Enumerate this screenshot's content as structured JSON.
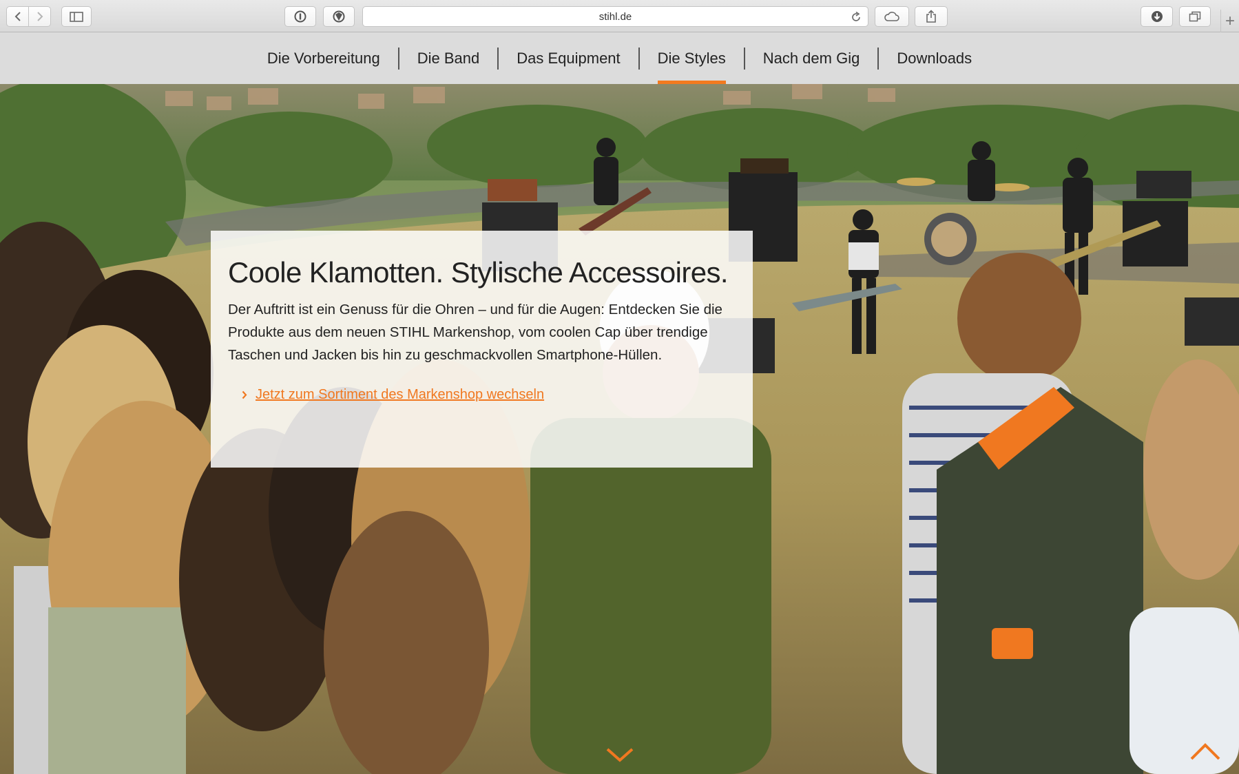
{
  "browser": {
    "url": "stihl.de"
  },
  "nav": {
    "items": [
      {
        "label": "Die Vorbereitung",
        "active": false
      },
      {
        "label": "Die Band",
        "active": false
      },
      {
        "label": "Das Equipment",
        "active": false
      },
      {
        "label": "Die Styles",
        "active": true
      },
      {
        "label": "Nach dem Gig",
        "active": false
      },
      {
        "label": "Downloads",
        "active": false
      }
    ]
  },
  "hero": {
    "title": "Coole Klamotten. Stylische Accessoires.",
    "body": "Der Auftritt ist ein Genuss für die Ohren – und für die Augen: Entdecken Sie die Produkte aus dem neuen STIHL Markenshop, vom coolen Cap über trendige Taschen und Jacken bis hin zu geschmackvollen Smartphone-Hüllen.",
    "link_label": "Jetzt zum Sortiment des Markenshop wechseln"
  },
  "colors": {
    "accent": "#f37a1f",
    "nav_bg": "#dcdcdc"
  }
}
